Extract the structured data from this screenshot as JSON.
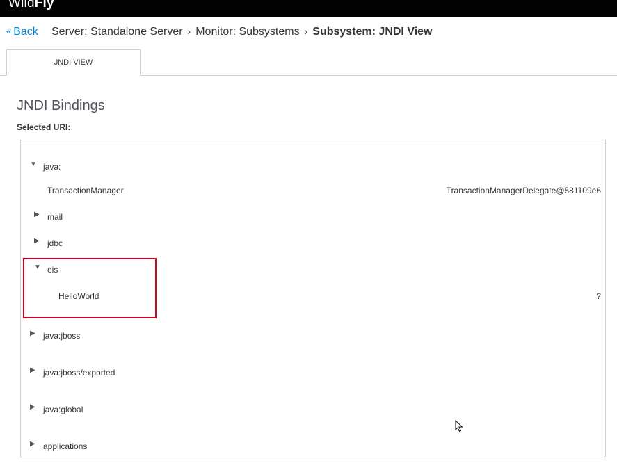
{
  "app": {
    "brand_part1": "Wild",
    "brand_part2": "Fly"
  },
  "nav": {
    "back_label": "Back",
    "breadcrumbs": [
      {
        "label": "Server: Standalone Server"
      },
      {
        "label": "Monitor: Subsystems"
      },
      {
        "label": "Subsystem: JNDI View"
      }
    ]
  },
  "tabs": [
    {
      "label": "JNDI VIEW",
      "active": true
    }
  ],
  "page": {
    "title": "JNDI Bindings",
    "selected_uri_label": "Selected URI:"
  },
  "tree": [
    {
      "label": "java:",
      "expanded": true,
      "arrow": "▼"
    },
    {
      "label": "TransactionManager",
      "value": "TransactionManagerDelegate@581109e6"
    },
    {
      "label": "mail",
      "expanded": false,
      "arrow": "▶"
    },
    {
      "label": "jdbc",
      "expanded": false,
      "arrow": "▶"
    },
    {
      "label": "eis",
      "expanded": true,
      "arrow": "▼"
    },
    {
      "label": "HelloWorld",
      "value": "?"
    },
    {
      "label": "java:jboss",
      "expanded": false,
      "arrow": "▶"
    },
    {
      "label": "java:jboss/exported",
      "expanded": false,
      "arrow": "▶"
    },
    {
      "label": "java:global",
      "expanded": false,
      "arrow": "▶"
    },
    {
      "label": "applications",
      "expanded": false,
      "arrow": "▶"
    }
  ],
  "colors": {
    "link": "#0088ce",
    "highlight_border": "#d0021b",
    "topbar": "#030303"
  },
  "icons": {
    "back": "double-chevron-left-icon",
    "separator": "chevron-right-icon",
    "expand": "caret-right-icon",
    "collapse": "caret-down-icon"
  }
}
